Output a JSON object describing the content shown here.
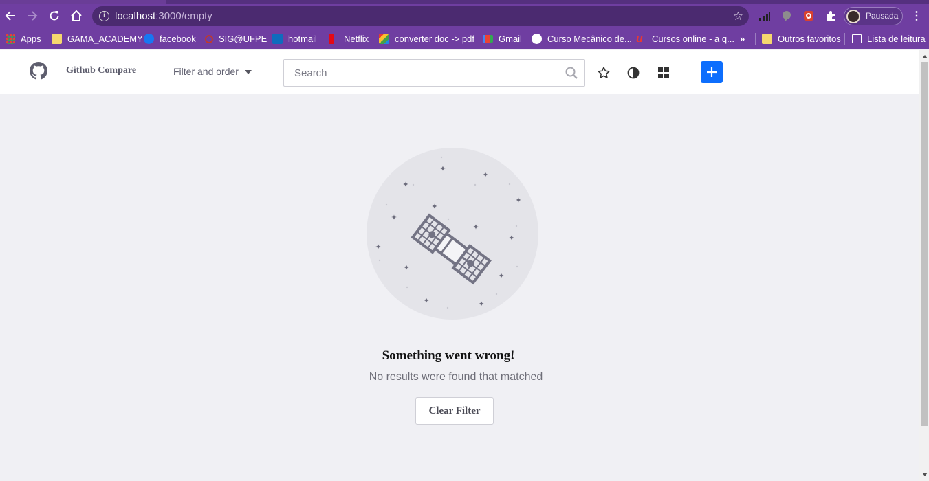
{
  "browser": {
    "url_host": "localhost",
    "url_path": ":3000/empty",
    "profile_label": "Pausada",
    "bookmarks": [
      {
        "label": "Apps",
        "icon": "apps-grid-icon"
      },
      {
        "label": "GAMA_ACADEMY",
        "icon": "folder-icon"
      },
      {
        "label": "facebook",
        "icon": "facebook-icon"
      },
      {
        "label": "SIG@UFPE",
        "icon": "sig-icon"
      },
      {
        "label": "hotmail",
        "icon": "outlook-icon"
      },
      {
        "label": "Netflix",
        "icon": "netflix-icon"
      },
      {
        "label": "converter doc -> pdf",
        "icon": "converter-icon"
      },
      {
        "label": "Gmail",
        "icon": "gmail-icon"
      },
      {
        "label": "Curso Mecânico de...",
        "icon": "course-icon"
      },
      {
        "label": "Cursos online - a q...",
        "icon": "udemy-icon"
      }
    ],
    "overflow_label": "»",
    "other_favorites": "Outros favoritos",
    "reading_list": "Lista de leitura"
  },
  "header": {
    "brand": "Github Compare",
    "filter_label": "Filter and order",
    "search_placeholder": "Search"
  },
  "empty_state": {
    "title": "Something went wrong!",
    "subtitle": "No results were found that matched",
    "button_label": "Clear Filter"
  },
  "colors": {
    "chrome": "#6f3ea1",
    "accent": "#0d6efd",
    "background": "#f0f0f4"
  }
}
